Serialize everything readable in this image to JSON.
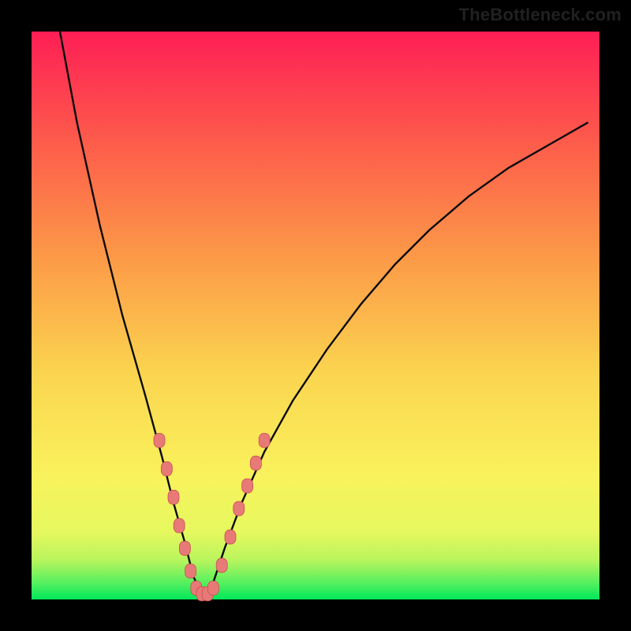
{
  "watermark": "TheBottleneck.com",
  "chart_data": {
    "type": "line",
    "title": "",
    "xlabel": "",
    "ylabel": "",
    "xlim": [
      0,
      100
    ],
    "ylim": [
      0,
      100
    ],
    "curve": {
      "name": "bottleneck-curve",
      "x": [
        5,
        8,
        12,
        16,
        20,
        23,
        25,
        27,
        28.5,
        30,
        31,
        32,
        34,
        37,
        41,
        46,
        52,
        58,
        64,
        70,
        77,
        84,
        91,
        98
      ],
      "y": [
        100,
        84,
        66,
        50,
        36,
        25,
        17,
        10,
        4,
        1,
        1,
        3,
        9,
        17,
        26,
        35,
        44,
        52,
        59,
        65,
        71,
        76,
        80,
        84
      ]
    },
    "markers": [
      {
        "x": 22.5,
        "y": 28
      },
      {
        "x": 23.8,
        "y": 23
      },
      {
        "x": 25.0,
        "y": 18
      },
      {
        "x": 26.0,
        "y": 13
      },
      {
        "x": 27.0,
        "y": 9
      },
      {
        "x": 28.0,
        "y": 5
      },
      {
        "x": 29.0,
        "y": 2
      },
      {
        "x": 30.0,
        "y": 1
      },
      {
        "x": 31.0,
        "y": 1
      },
      {
        "x": 32.0,
        "y": 2
      },
      {
        "x": 33.5,
        "y": 6
      },
      {
        "x": 35.0,
        "y": 11
      },
      {
        "x": 36.5,
        "y": 16
      },
      {
        "x": 38.0,
        "y": 20
      },
      {
        "x": 39.5,
        "y": 24
      },
      {
        "x": 41.0,
        "y": 28
      }
    ],
    "colors": {
      "curve_stroke": "#0b0b0b",
      "marker_fill": "#e77a77",
      "marker_stroke": "#c94f4f"
    }
  }
}
